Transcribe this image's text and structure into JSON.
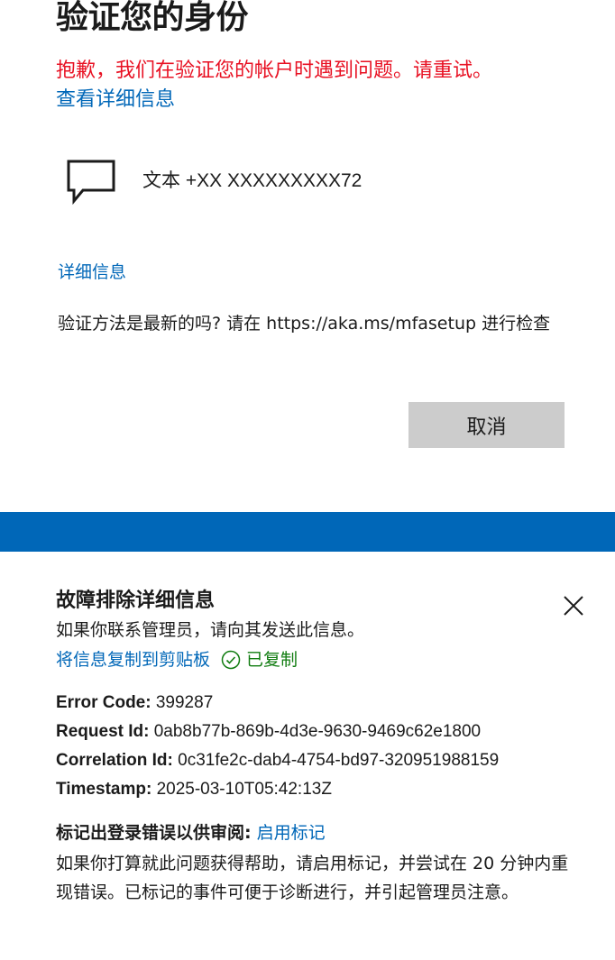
{
  "verify": {
    "title": "验证您的身份",
    "error_message": "抱歉，我们在验证您的帐户时遇到问题。请重试。",
    "view_details_link": "查看详细信息",
    "method": {
      "icon": "message-icon",
      "label": "文本 +XX XXXXXXXXX72"
    },
    "more_info_link": "详细信息",
    "check_method_text": "验证方法是最新的吗? 请在 https://aka.ms/mfasetup 进行检查",
    "cancel_button": "取消"
  },
  "troubleshooting": {
    "title": "故障排除详细信息",
    "description": "如果你联系管理员，请向其发送此信息。",
    "copy_link": "将信息复制到剪贴板",
    "copied_status": "已复制",
    "fields": [
      {
        "label": "Error Code:",
        "value": "399287"
      },
      {
        "label": "Request Id:",
        "value": "0ab8b77b-869b-4d3e-9630-9469c62e1800"
      },
      {
        "label": "Correlation Id:",
        "value": "0c31fe2c-dab4-4754-bd97-320951988159"
      },
      {
        "label": "Timestamp:",
        "value": "2025-03-10T05:42:13Z"
      }
    ],
    "flag_label": "标记出登录错误以供审阅:",
    "flag_link": "启用标记",
    "flag_description": "如果你打算就此问题获得帮助，请启用标记，并尝试在 20 分钟内重现错误。已标记的事件可便于诊断进行，并引起管理员注意。"
  },
  "colors": {
    "accent": "#0067b8",
    "error": "#e81123",
    "success": "#107c10",
    "button_bg": "#cccccc"
  }
}
